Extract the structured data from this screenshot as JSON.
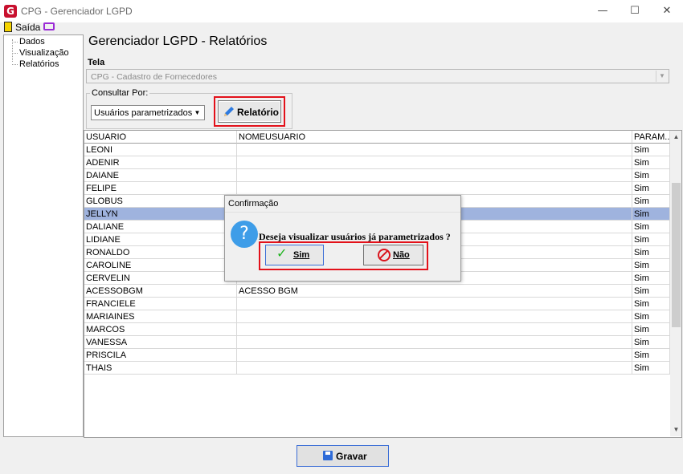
{
  "window": {
    "title": "CPG - Gerenciador LGPD",
    "app_icon_letter": "G",
    "minimize": "—",
    "maximize": "☐",
    "close": "✕"
  },
  "menu": {
    "exit_label": "Saída"
  },
  "tree": {
    "items": [
      "Dados",
      "Visualização",
      "Relatórios"
    ]
  },
  "main": {
    "title": "Gerenciador LGPD - Relatórios",
    "tela_label": "Tela",
    "tela_value": "CPG - Cadastro de Fornecedores",
    "consultar_label": "Consultar Por:",
    "consultar_value": "Usuários parametrizados",
    "relatorio_button": "Relatório"
  },
  "grid": {
    "columns": [
      "USUARIO",
      "NOMEUSUARIO",
      "PARAM..."
    ],
    "rows": [
      [
        "LEONI",
        "",
        "Sim"
      ],
      [
        "ADENIR",
        "",
        "Sim"
      ],
      [
        "DAIANE",
        "",
        "Sim"
      ],
      [
        "FELIPE",
        "",
        "Sim"
      ],
      [
        "GLOBUS",
        "",
        "Sim"
      ],
      [
        "JELLYN",
        "",
        "Sim"
      ],
      [
        "DALIANE",
        "",
        "Sim"
      ],
      [
        "LIDIANE",
        "",
        "Sim"
      ],
      [
        "RONALDO",
        "",
        "Sim"
      ],
      [
        "CAROLINE",
        "",
        "Sim"
      ],
      [
        "CERVELIN",
        "",
        "Sim"
      ],
      [
        "ACESSOBGM",
        "ACESSO BGM",
        "Sim"
      ],
      [
        "FRANCIELE",
        "",
        "Sim"
      ],
      [
        "MARIAINES",
        "",
        "Sim"
      ],
      [
        "MARCOS",
        "",
        "Sim"
      ],
      [
        "VANESSA",
        "",
        "Sim"
      ],
      [
        "PRISCILA",
        "",
        "Sim"
      ],
      [
        "THAIS",
        "",
        "Sim"
      ]
    ],
    "selected_row": 5
  },
  "footer": {
    "gravar_button": "Gravar"
  },
  "dialog": {
    "title": "Confirmação",
    "message": "Deseja visualizar usuários já parametrizados ?",
    "yes_button": "Sim",
    "no_button": "Não"
  },
  "colors": {
    "highlight": "#e3111a",
    "selected_row": "#9fb3de",
    "brand": "#c8102e",
    "question": "#3e9de8"
  }
}
